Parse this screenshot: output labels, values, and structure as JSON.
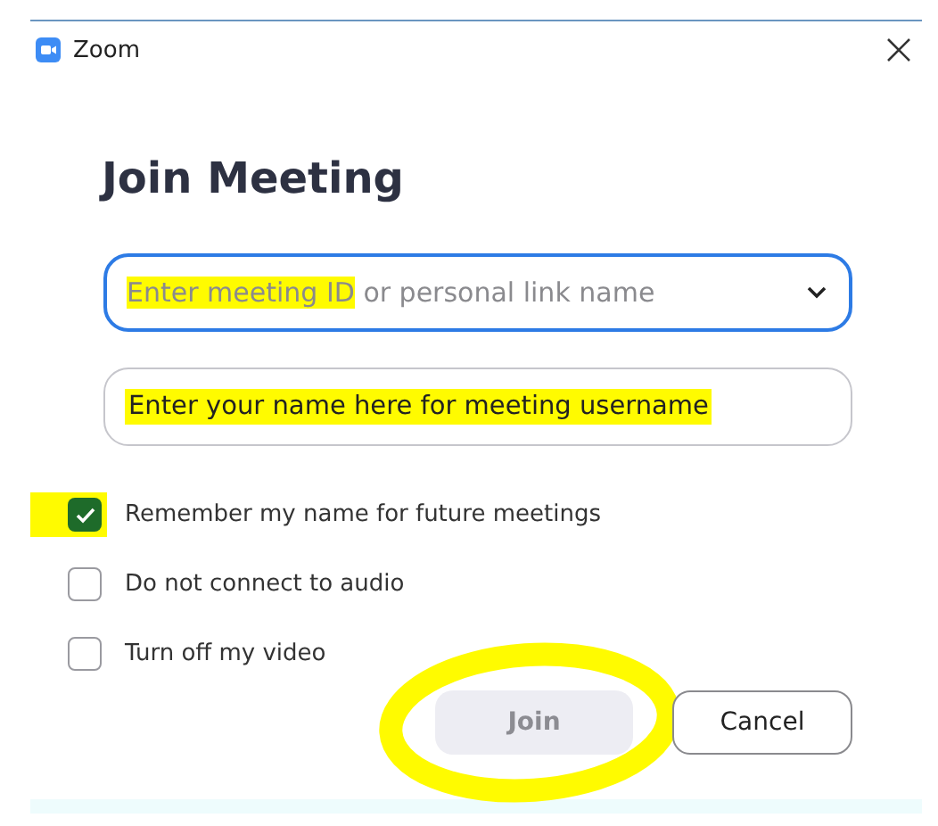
{
  "window": {
    "title": "Zoom"
  },
  "heading": "Join Meeting",
  "meeting_field": {
    "parts": [
      {
        "text": "Enter meeting ID",
        "highlighted": true
      },
      {
        "text": " or personal link name",
        "highlighted": false
      }
    ],
    "focused": true
  },
  "name_field": {
    "value": "Enter your name here for meeting username",
    "highlighted": true,
    "focused": false
  },
  "options": [
    {
      "label": "Remember my name for future meetings",
      "checked": true,
      "highlighted": true
    },
    {
      "label": "Do not connect to audio",
      "checked": false,
      "highlighted": false
    },
    {
      "label": "Turn off my video",
      "checked": false,
      "highlighted": false
    }
  ],
  "buttons": [
    {
      "label": "Join",
      "kind": "primary",
      "disabled": true,
      "circled": true
    },
    {
      "label": "Cancel",
      "kind": "secondary",
      "disabled": false,
      "circled": false
    }
  ]
}
